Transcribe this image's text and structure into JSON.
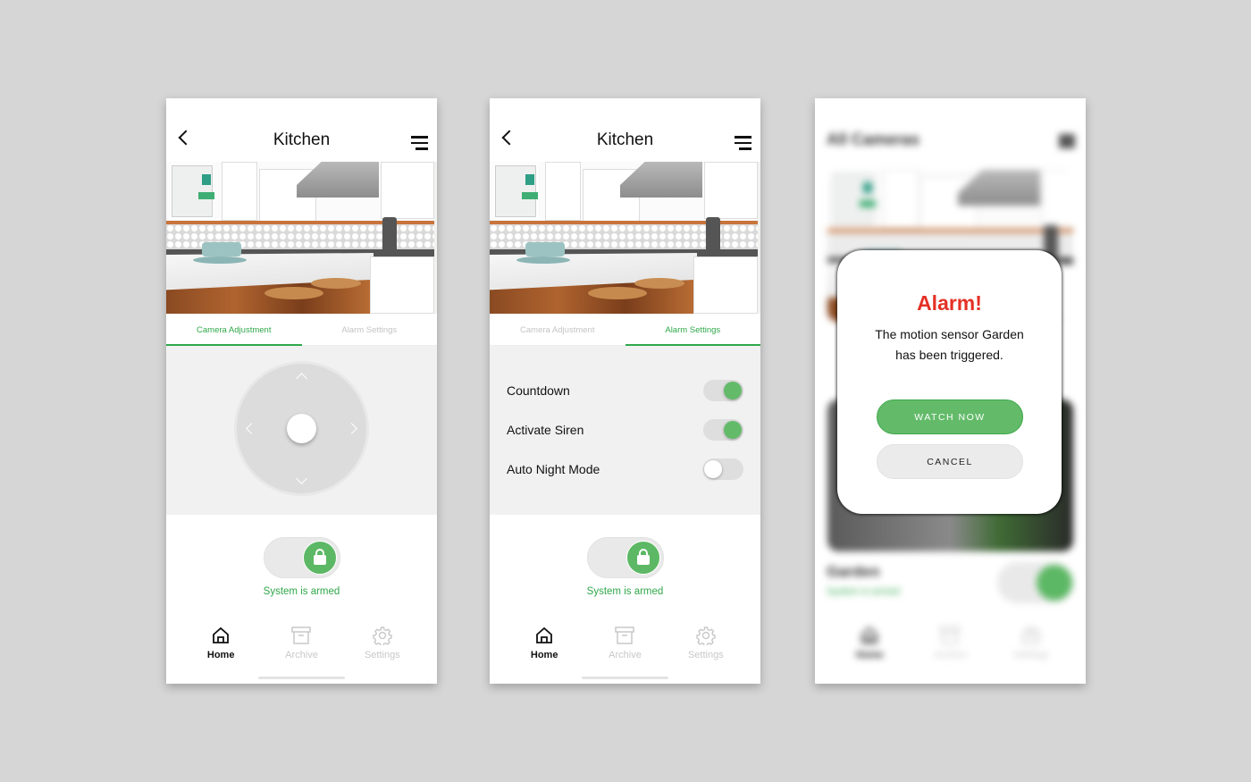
{
  "colors": {
    "accent": "#2fa84a",
    "toggle_on": "#63bb6a",
    "alarm": "#e43025",
    "background": "#d6d6d6"
  },
  "screen1": {
    "title": "Kitchen",
    "live": "live",
    "tabs": [
      "Camera Adjustment",
      "Alarm Settings"
    ],
    "active_tab": 0,
    "arm_status": "System is armed",
    "armed": true
  },
  "screen2": {
    "title": "Kitchen",
    "live": "live",
    "tabs": [
      "Camera Adjustment",
      "Alarm Settings"
    ],
    "active_tab": 1,
    "settings": [
      {
        "label": "Countdown",
        "on": true
      },
      {
        "label": "Activate Siren",
        "on": true
      },
      {
        "label": "Auto Night Mode",
        "on": false
      }
    ],
    "arm_status": "System is armed",
    "armed": true
  },
  "nav": [
    {
      "label": "Home",
      "icon": "home-icon",
      "active": true
    },
    {
      "label": "Archive",
      "icon": "archive-icon"
    },
    {
      "label": "Settings",
      "icon": "gear-icon"
    }
  ],
  "screen3": {
    "bg_title": "All Cameras",
    "bg_camera": "Garden",
    "bg_status": "System is armed",
    "modal": {
      "title": "Alarm!",
      "message_line1": "The motion sensor Garden",
      "message_line2": "has been triggered.",
      "watch_label": "WATCH NOW",
      "cancel_label": "CANCEL"
    }
  }
}
